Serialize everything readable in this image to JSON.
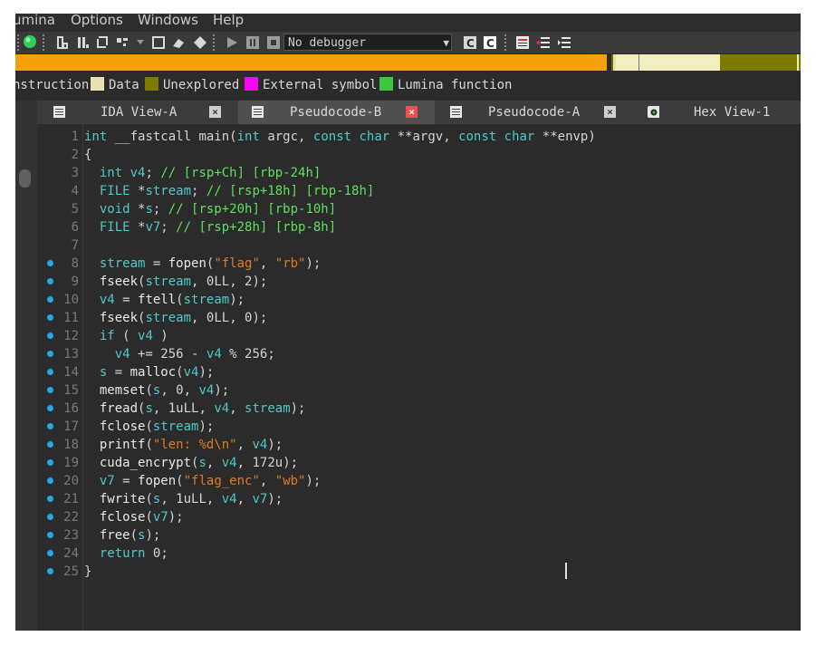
{
  "menu": [
    "umina",
    "Options",
    "Windows",
    "Help"
  ],
  "toolbar": {
    "debugger_select": "No debugger",
    "icons": [
      "status-green-icon",
      "edit-icon",
      "ida-icon",
      "refresh-icon",
      "patch-icon",
      "box-icon",
      "graph-icon",
      "diamond-icon",
      "play-icon",
      "pause-icon",
      "stop-icon",
      "c-icon",
      "c2-icon",
      "list-icon",
      "list2-icon",
      "list3-icon"
    ]
  },
  "legend": [
    {
      "label": "nstruction",
      "color": ""
    },
    {
      "label": "Data",
      "color": "#e8e2b0"
    },
    {
      "label": "Unexplored",
      "color": "#7d7a00"
    },
    {
      "label": "External symbol",
      "color": "#ff00ff"
    },
    {
      "label": "Lumina function",
      "color": "#3cc83c"
    }
  ],
  "tabs": [
    {
      "label": "IDA View-A",
      "active": false
    },
    {
      "label": "Pseudocode-B",
      "active": true
    },
    {
      "label": "Pseudocode-A",
      "active": false
    },
    {
      "label": "Hex View-1",
      "active": false
    }
  ],
  "code": [
    {
      "n": "1",
      "bp": false,
      "t": [
        [
          "kw",
          "int"
        ],
        [
          "id",
          " __fastcall main("
        ],
        [
          "kw",
          "int"
        ],
        [
          "id",
          " argc, "
        ],
        [
          "kw",
          "const char"
        ],
        [
          "id",
          " **argv, "
        ],
        [
          "kw",
          "const char"
        ],
        [
          "id",
          " **envp)"
        ]
      ]
    },
    {
      "n": "2",
      "bp": false,
      "t": [
        [
          "pun",
          "{"
        ]
      ]
    },
    {
      "n": "3",
      "bp": false,
      "t": [
        [
          "id",
          "  "
        ],
        [
          "kw",
          "int"
        ],
        [
          "var",
          " v4"
        ],
        [
          "pun",
          "; "
        ],
        [
          "cmt",
          "// [rsp+Ch] [rbp-24h]"
        ]
      ]
    },
    {
      "n": "4",
      "bp": false,
      "t": [
        [
          "id",
          "  "
        ],
        [
          "kw",
          "FILE"
        ],
        [
          "id",
          " *"
        ],
        [
          "var",
          "stream"
        ],
        [
          "pun",
          "; "
        ],
        [
          "cmt",
          "// [rsp+18h] [rbp-18h]"
        ]
      ]
    },
    {
      "n": "5",
      "bp": false,
      "t": [
        [
          "id",
          "  "
        ],
        [
          "kw",
          "void"
        ],
        [
          "id",
          " *"
        ],
        [
          "var",
          "s"
        ],
        [
          "pun",
          "; "
        ],
        [
          "cmt",
          "// [rsp+20h] [rbp-10h]"
        ]
      ]
    },
    {
      "n": "6",
      "bp": false,
      "t": [
        [
          "id",
          "  "
        ],
        [
          "kw",
          "FILE"
        ],
        [
          "id",
          " *"
        ],
        [
          "var",
          "v7"
        ],
        [
          "pun",
          "; "
        ],
        [
          "cmt",
          "// [rsp+28h] [rbp-8h]"
        ]
      ]
    },
    {
      "n": "7",
      "bp": false,
      "t": []
    },
    {
      "n": "8",
      "bp": true,
      "t": [
        [
          "id",
          "  "
        ],
        [
          "var",
          "stream"
        ],
        [
          "pun",
          " = "
        ],
        [
          "fn",
          "fopen"
        ],
        [
          "pun",
          "("
        ],
        [
          "str",
          "\"flag\""
        ],
        [
          "pun",
          ", "
        ],
        [
          "str",
          "\"rb\""
        ],
        [
          "pun",
          ");"
        ]
      ]
    },
    {
      "n": "9",
      "bp": true,
      "t": [
        [
          "id",
          "  "
        ],
        [
          "fn",
          "fseek"
        ],
        [
          "pun",
          "("
        ],
        [
          "var",
          "stream"
        ],
        [
          "pun",
          ", "
        ],
        [
          "num",
          "0LL"
        ],
        [
          "pun",
          ", "
        ],
        [
          "num",
          "2"
        ],
        [
          "pun",
          ");"
        ]
      ]
    },
    {
      "n": "10",
      "bp": true,
      "t": [
        [
          "id",
          "  "
        ],
        [
          "var",
          "v4"
        ],
        [
          "pun",
          " = "
        ],
        [
          "fn",
          "ftell"
        ],
        [
          "pun",
          "("
        ],
        [
          "var",
          "stream"
        ],
        [
          "pun",
          ");"
        ]
      ]
    },
    {
      "n": "11",
      "bp": true,
      "t": [
        [
          "id",
          "  "
        ],
        [
          "fn",
          "fseek"
        ],
        [
          "pun",
          "("
        ],
        [
          "var",
          "stream"
        ],
        [
          "pun",
          ", "
        ],
        [
          "num",
          "0LL"
        ],
        [
          "pun",
          ", "
        ],
        [
          "num",
          "0"
        ],
        [
          "pun",
          ");"
        ]
      ]
    },
    {
      "n": "12",
      "bp": true,
      "t": [
        [
          "id",
          "  "
        ],
        [
          "kw",
          "if"
        ],
        [
          "pun",
          " ( "
        ],
        [
          "var",
          "v4"
        ],
        [
          "pun",
          " )"
        ]
      ]
    },
    {
      "n": "13",
      "bp": true,
      "t": [
        [
          "id",
          "    "
        ],
        [
          "var",
          "v4"
        ],
        [
          "pun",
          " += "
        ],
        [
          "num",
          "256"
        ],
        [
          "pun",
          " - "
        ],
        [
          "var",
          "v4"
        ],
        [
          "pun",
          " % "
        ],
        [
          "num",
          "256"
        ],
        [
          "pun",
          ";"
        ]
      ]
    },
    {
      "n": "14",
      "bp": true,
      "t": [
        [
          "id",
          "  "
        ],
        [
          "var",
          "s"
        ],
        [
          "pun",
          " = "
        ],
        [
          "fn",
          "malloc"
        ],
        [
          "pun",
          "("
        ],
        [
          "var",
          "v4"
        ],
        [
          "pun",
          ");"
        ]
      ]
    },
    {
      "n": "15",
      "bp": true,
      "t": [
        [
          "id",
          "  "
        ],
        [
          "fn",
          "memset"
        ],
        [
          "pun",
          "("
        ],
        [
          "var",
          "s"
        ],
        [
          "pun",
          ", "
        ],
        [
          "num",
          "0"
        ],
        [
          "pun",
          ", "
        ],
        [
          "var",
          "v4"
        ],
        [
          "pun",
          ");"
        ]
      ]
    },
    {
      "n": "16",
      "bp": true,
      "t": [
        [
          "id",
          "  "
        ],
        [
          "fn",
          "fread"
        ],
        [
          "pun",
          "("
        ],
        [
          "var",
          "s"
        ],
        [
          "pun",
          ", "
        ],
        [
          "num",
          "1uLL"
        ],
        [
          "pun",
          ", "
        ],
        [
          "var",
          "v4"
        ],
        [
          "pun",
          ", "
        ],
        [
          "var",
          "stream"
        ],
        [
          "pun",
          ");"
        ]
      ]
    },
    {
      "n": "17",
      "bp": true,
      "t": [
        [
          "id",
          "  "
        ],
        [
          "fn",
          "fclose"
        ],
        [
          "pun",
          "("
        ],
        [
          "var",
          "stream"
        ],
        [
          "pun",
          ");"
        ]
      ]
    },
    {
      "n": "18",
      "bp": true,
      "t": [
        [
          "id",
          "  "
        ],
        [
          "fn",
          "printf"
        ],
        [
          "pun",
          "("
        ],
        [
          "str",
          "\"len: %d\\n\""
        ],
        [
          "pun",
          ", "
        ],
        [
          "var",
          "v4"
        ],
        [
          "pun",
          ");"
        ]
      ]
    },
    {
      "n": "19",
      "bp": true,
      "t": [
        [
          "id",
          "  "
        ],
        [
          "fn",
          "cuda_encrypt"
        ],
        [
          "pun",
          "("
        ],
        [
          "var",
          "s"
        ],
        [
          "pun",
          ", "
        ],
        [
          "var",
          "v4"
        ],
        [
          "pun",
          ", "
        ],
        [
          "num",
          "172u"
        ],
        [
          "pun",
          ");"
        ]
      ]
    },
    {
      "n": "20",
      "bp": true,
      "t": [
        [
          "id",
          "  "
        ],
        [
          "var",
          "v7"
        ],
        [
          "pun",
          " = "
        ],
        [
          "fn",
          "fopen"
        ],
        [
          "pun",
          "("
        ],
        [
          "str",
          "\"flag_enc\""
        ],
        [
          "pun",
          ", "
        ],
        [
          "str",
          "\"wb\""
        ],
        [
          "pun",
          ");"
        ]
      ]
    },
    {
      "n": "21",
      "bp": true,
      "t": [
        [
          "id",
          "  "
        ],
        [
          "fn",
          "fwrite"
        ],
        [
          "pun",
          "("
        ],
        [
          "var",
          "s"
        ],
        [
          "pun",
          ", "
        ],
        [
          "num",
          "1uLL"
        ],
        [
          "pun",
          ", "
        ],
        [
          "var",
          "v4"
        ],
        [
          "pun",
          ", "
        ],
        [
          "var",
          "v7"
        ],
        [
          "pun",
          ");"
        ]
      ]
    },
    {
      "n": "22",
      "bp": true,
      "t": [
        [
          "id",
          "  "
        ],
        [
          "fn",
          "fclose"
        ],
        [
          "pun",
          "("
        ],
        [
          "var",
          "v7"
        ],
        [
          "pun",
          ");"
        ]
      ]
    },
    {
      "n": "23",
      "bp": true,
      "t": [
        [
          "id",
          "  "
        ],
        [
          "fn",
          "free"
        ],
        [
          "pun",
          "("
        ],
        [
          "var",
          "s"
        ],
        [
          "pun",
          ");"
        ]
      ]
    },
    {
      "n": "24",
      "bp": true,
      "t": [
        [
          "id",
          "  "
        ],
        [
          "kw",
          "return"
        ],
        [
          "pun",
          " "
        ],
        [
          "num",
          "0"
        ],
        [
          "pun",
          ";"
        ]
      ]
    },
    {
      "n": "25",
      "bp": true,
      "t": [
        [
          "pun",
          "}"
        ]
      ]
    }
  ]
}
